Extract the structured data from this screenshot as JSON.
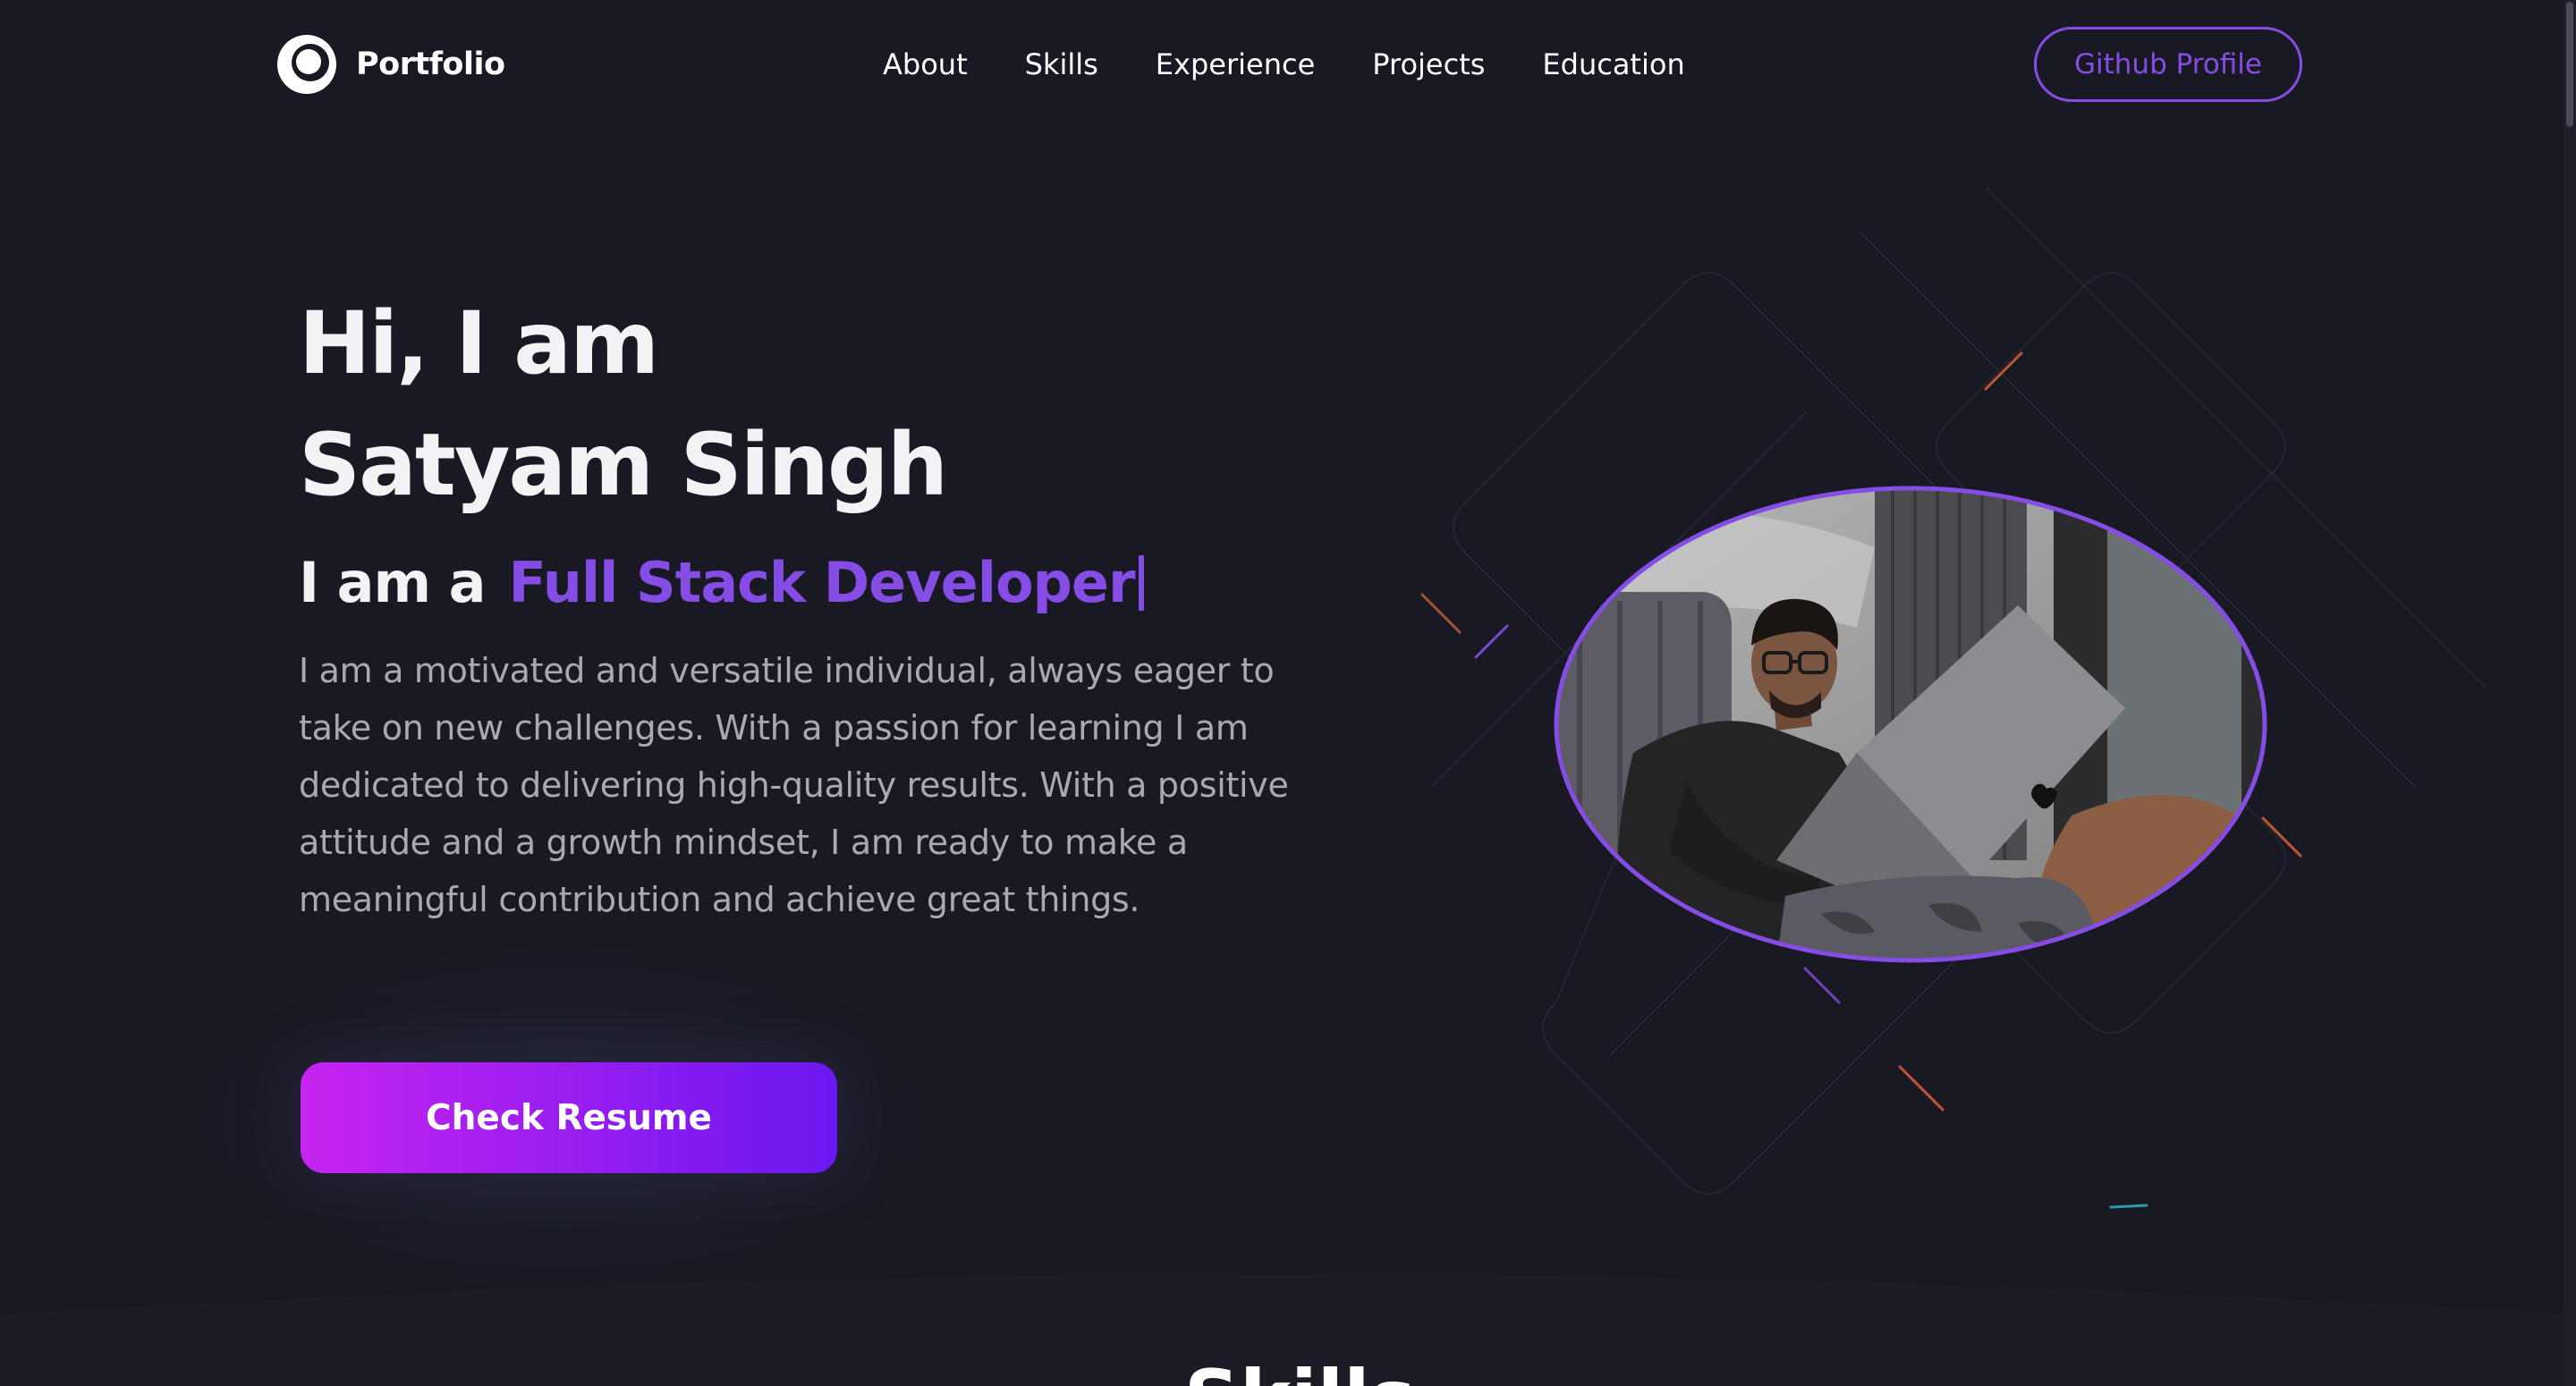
{
  "nav": {
    "logo_text": "Portfolio",
    "links": [
      "About",
      "Skills",
      "Experience",
      "Projects",
      "Education"
    ],
    "github_button": "Github Profile"
  },
  "hero": {
    "title_line1": "Hi, I am",
    "title_line2": "Satyam Singh",
    "role_prefix": "I am a",
    "role_value": "Full Stack Developer",
    "description": "I am a motivated and versatile individual, always eager to take on new challenges. With a passion for learning I am dedicated to delivering high-quality results. With a positive attitude and a growth mindset, I am ready to make a meaningful contribution and achieve great things.",
    "resume_button": "Check Resume"
  },
  "next_section": {
    "title": "Skills"
  },
  "colors": {
    "background": "#191923",
    "accent": "#854ce6",
    "text": "#f2f3f4",
    "muted_text": "#a9a9b3",
    "button_gradient_start": "#c724f0",
    "button_gradient_end": "#6b17f1"
  },
  "icons": {
    "logo": "portfolio-logo-icon"
  }
}
